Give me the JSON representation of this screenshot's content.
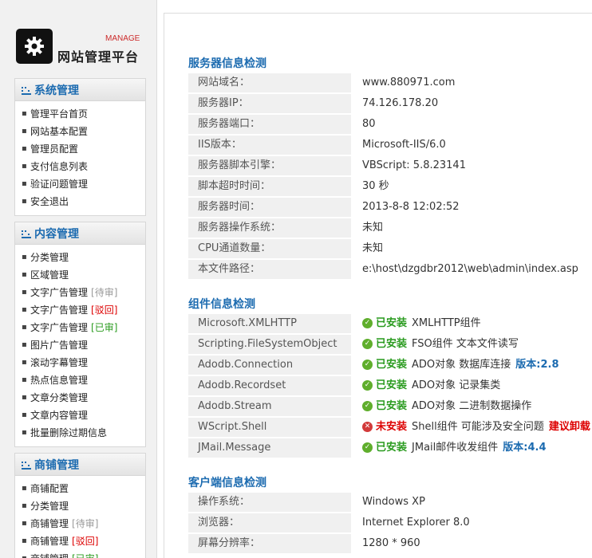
{
  "brand": {
    "title": "网站管理平台",
    "subtitle": "MANAGE",
    "icon": "gear-icon"
  },
  "menus": [
    {
      "title": "系统管理",
      "items": [
        {
          "label": "管理平台首页",
          "tag": ""
        },
        {
          "label": "网站基本配置",
          "tag": ""
        },
        {
          "label": "管理员配置",
          "tag": ""
        },
        {
          "label": "支付信息列表",
          "tag": ""
        },
        {
          "label": "验证问题管理",
          "tag": ""
        },
        {
          "label": "安全退出",
          "tag": ""
        }
      ]
    },
    {
      "title": "内容管理",
      "items": [
        {
          "label": "分类管理",
          "tag": ""
        },
        {
          "label": "区域管理",
          "tag": ""
        },
        {
          "label": "文字广告管理",
          "tag": "[待审]"
        },
        {
          "label": "文字广告管理",
          "tag": "[驳回]"
        },
        {
          "label": "文字广告管理",
          "tag": "[已审]"
        },
        {
          "label": "图片广告管理",
          "tag": ""
        },
        {
          "label": "滚动字幕管理",
          "tag": ""
        },
        {
          "label": "热点信息管理",
          "tag": ""
        },
        {
          "label": "文章分类管理",
          "tag": ""
        },
        {
          "label": "文章内容管理",
          "tag": ""
        },
        {
          "label": "批量删除过期信息",
          "tag": ""
        }
      ]
    },
    {
      "title": "商铺管理",
      "items": [
        {
          "label": "商铺配置",
          "tag": ""
        },
        {
          "label": "分类管理",
          "tag": ""
        },
        {
          "label": "商铺管理",
          "tag": "[待审]"
        },
        {
          "label": "商铺管理",
          "tag": "[驳回]"
        },
        {
          "label": "商铺管理",
          "tag": "[已审]"
        }
      ]
    }
  ],
  "server": {
    "title": "服务器信息检测",
    "rows": [
      {
        "key": "网站域名：",
        "value": "www.880971.com"
      },
      {
        "key": "服务器IP：",
        "value": "74.126.178.20"
      },
      {
        "key": "服务器端口：",
        "value": "80"
      },
      {
        "key": "IIS版本：",
        "value": "Microsoft-IIS/6.0"
      },
      {
        "key": "服务器脚本引擎：",
        "value": "VBScript: 5.8.23141"
      },
      {
        "key": "脚本超时时间：",
        "value": "30 秒"
      },
      {
        "key": "服务器时间：",
        "value": "2013-8-8 12:02:52"
      },
      {
        "key": "服务器操作系统：",
        "value": "未知"
      },
      {
        "key": "CPU通道数量：",
        "value": "未知"
      },
      {
        "key": "本文件路径：",
        "value": "e:\\host\\dzgdbr2012\\web\\admin\\index.asp"
      }
    ]
  },
  "components": {
    "title": "组件信息检测",
    "rows": [
      {
        "key": "Microsoft.XMLHTTP",
        "status": "已安装",
        "ok": true,
        "desc": "XMLHTTP组件",
        "extra": ""
      },
      {
        "key": "Scripting.FileSystemObject",
        "status": "已安装",
        "ok": true,
        "desc": "FSO组件 文本文件读写",
        "extra": ""
      },
      {
        "key": "Adodb.Connection",
        "status": "已安装",
        "ok": true,
        "desc": "ADO对象 数据库连接",
        "extra": "版本:2.8"
      },
      {
        "key": "Adodb.Recordset",
        "status": "已安装",
        "ok": true,
        "desc": "ADO对象 记录集类",
        "extra": ""
      },
      {
        "key": "Adodb.Stream",
        "status": "已安装",
        "ok": true,
        "desc": "ADO对象 二进制数据操作",
        "extra": ""
      },
      {
        "key": "WScript.Shell",
        "status": "未安装",
        "ok": false,
        "desc": "Shell组件 可能涉及安全问题",
        "extra": "建议卸载"
      },
      {
        "key": "JMail.Message",
        "status": "已安装",
        "ok": true,
        "desc": "JMail邮件收发组件",
        "extra": "版本:4.4"
      }
    ]
  },
  "client": {
    "title": "客户端信息检测",
    "rows": [
      {
        "key": "操作系统：",
        "value": "Windows XP"
      },
      {
        "key": "浏览器：",
        "value": "Internet Explorer 8.0"
      },
      {
        "key": "屏幕分辨率：",
        "value": "1280 * 960"
      }
    ]
  },
  "colors": {
    "accent": "#1c6bb0",
    "ok": "#2a9b1f",
    "danger": "#dd0000"
  }
}
